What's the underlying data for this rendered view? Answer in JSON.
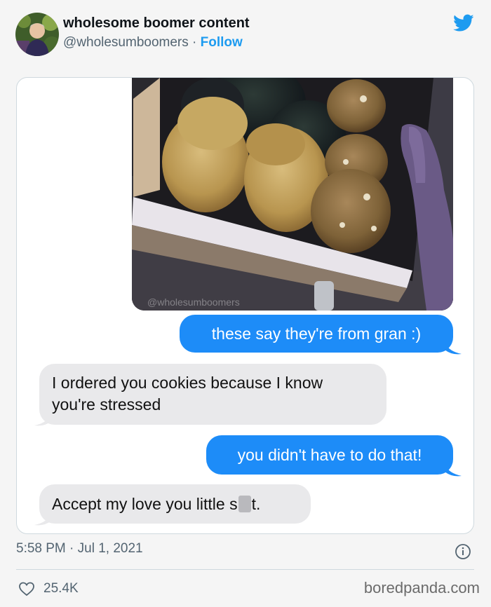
{
  "tweet": {
    "display_name": "wholesome boomer content",
    "handle": "@wholesumboomers",
    "separator": "·",
    "follow_label": "Follow",
    "timestamp": "5:58 PM · Jul 1, 2021",
    "likes": "25.4K"
  },
  "image": {
    "watermark": "@wholesumboomers"
  },
  "messages": [
    {
      "side": "sent",
      "text": "these say they're from gran :)"
    },
    {
      "side": "received",
      "lines": [
        "I ordered you cookies because I know",
        "you're stressed"
      ]
    },
    {
      "side": "sent",
      "text": "you didn't have to do that!"
    },
    {
      "side": "received",
      "text_before": "Accept my love you little s",
      "text_after": "t."
    }
  ],
  "footer": {
    "brand": "boredpanda.com"
  },
  "colors": {
    "twitter_blue": "#1d9bf0",
    "sent_bubble": "#1d8cf8",
    "received_bubble": "#e9e9eb"
  },
  "icons": [
    "twitter-bird-icon",
    "info-icon",
    "heart-icon"
  ]
}
